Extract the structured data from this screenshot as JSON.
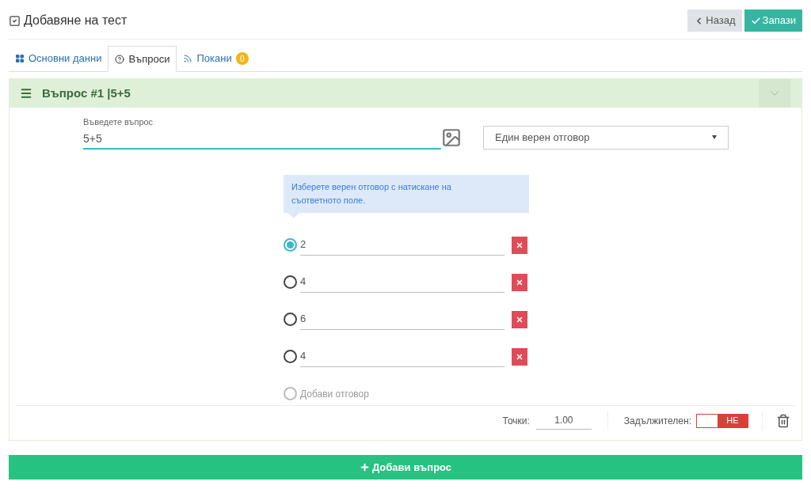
{
  "page": {
    "title": "Добавяне на тест"
  },
  "buttons": [
    {
      "kind": "back",
      "label": "Назад"
    },
    {
      "kind": "save",
      "label": "Запази"
    }
  ],
  "tabs": [
    {
      "kind": "grid",
      "label": "Основни данни",
      "selected": false
    },
    {
      "kind": "question",
      "label": "Въпроси",
      "selected": true
    },
    {
      "kind": "feed",
      "label": "Покани",
      "selected": false,
      "badge": "0"
    }
  ],
  "question": {
    "title": "Въпрос #1 |5+5",
    "expanded": true,
    "field_label": "Въведете въпрос",
    "value": "5+5",
    "type": "Един верен отговор",
    "hint": "Изберете верен отговор с натискане на съответното поле.",
    "answers": [
      {
        "value": "2",
        "selected": true
      },
      {
        "value": "4",
        "selected": false
      },
      {
        "value": "6",
        "selected": false
      },
      {
        "value": "4",
        "selected": false
      }
    ],
    "add_answer": "Добави отговор",
    "points_label": "Точки:",
    "points": "1.00",
    "required_label": "Задължителен:",
    "required": {
      "on": false,
      "label": "НЕ"
    }
  },
  "add_question": "Добави въпрос"
}
